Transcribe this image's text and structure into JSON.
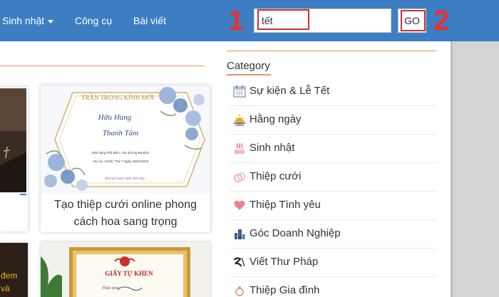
{
  "nav": {
    "items": [
      {
        "label": "Sinh nhật",
        "has_dropdown": true
      },
      {
        "label": "Công cụ",
        "has_dropdown": false
      },
      {
        "label": "Bài viết",
        "has_dropdown": false
      }
    ]
  },
  "search": {
    "value": "tết",
    "go_label": "GO"
  },
  "annotations": {
    "step1": "1",
    "step2": "2"
  },
  "cards": [
    {
      "title_line1": "Tạo thiệp cưới online phong",
      "title_line2": "cách hoa sang trọng",
      "invite": {
        "heading": "TRÂN TRỌNG KÍNH MỜI",
        "name1": "Hữu Hùng",
        "name2": "Thanh Tâm",
        "venue": "Nhà hàng Phố Biển, 135 đường Ba Biển",
        "time": "Vào lúc 11h30, Thứ 7 Ngày 29/02/2020",
        "footer": "Rất hân hạnh được đón tiếp"
      }
    },
    {
      "certificate_title": "GIẤY TỰ KHEN",
      "certificate_line": "Thân tặng"
    }
  ],
  "left_card_text": [
    "đem",
    "và"
  ],
  "sidebar": {
    "heading": "Category",
    "categories": [
      {
        "label": "Sự kiện & Lễ Tết",
        "icon": "calendar-icon"
      },
      {
        "label": "Hằng ngày",
        "icon": "sunrise-icon"
      },
      {
        "label": "Sinh nhật",
        "icon": "cake-icon"
      },
      {
        "label": "Thiệp cưới",
        "icon": "rings-icon"
      },
      {
        "label": "Thiệp Tình yêu",
        "icon": "heart-icon"
      },
      {
        "label": "Góc Doanh Nghiệp",
        "icon": "building-icon"
      },
      {
        "label": "Viết Thư Pháp",
        "icon": "calligraphy-icon"
      },
      {
        "label": "Thiệp Gia đình",
        "icon": "family-icon"
      }
    ]
  },
  "colors": {
    "navbar": "#3d7ec3",
    "accent_line": "#e0956c",
    "annotation_red": "#e8322d",
    "heart": "#e8828f"
  }
}
